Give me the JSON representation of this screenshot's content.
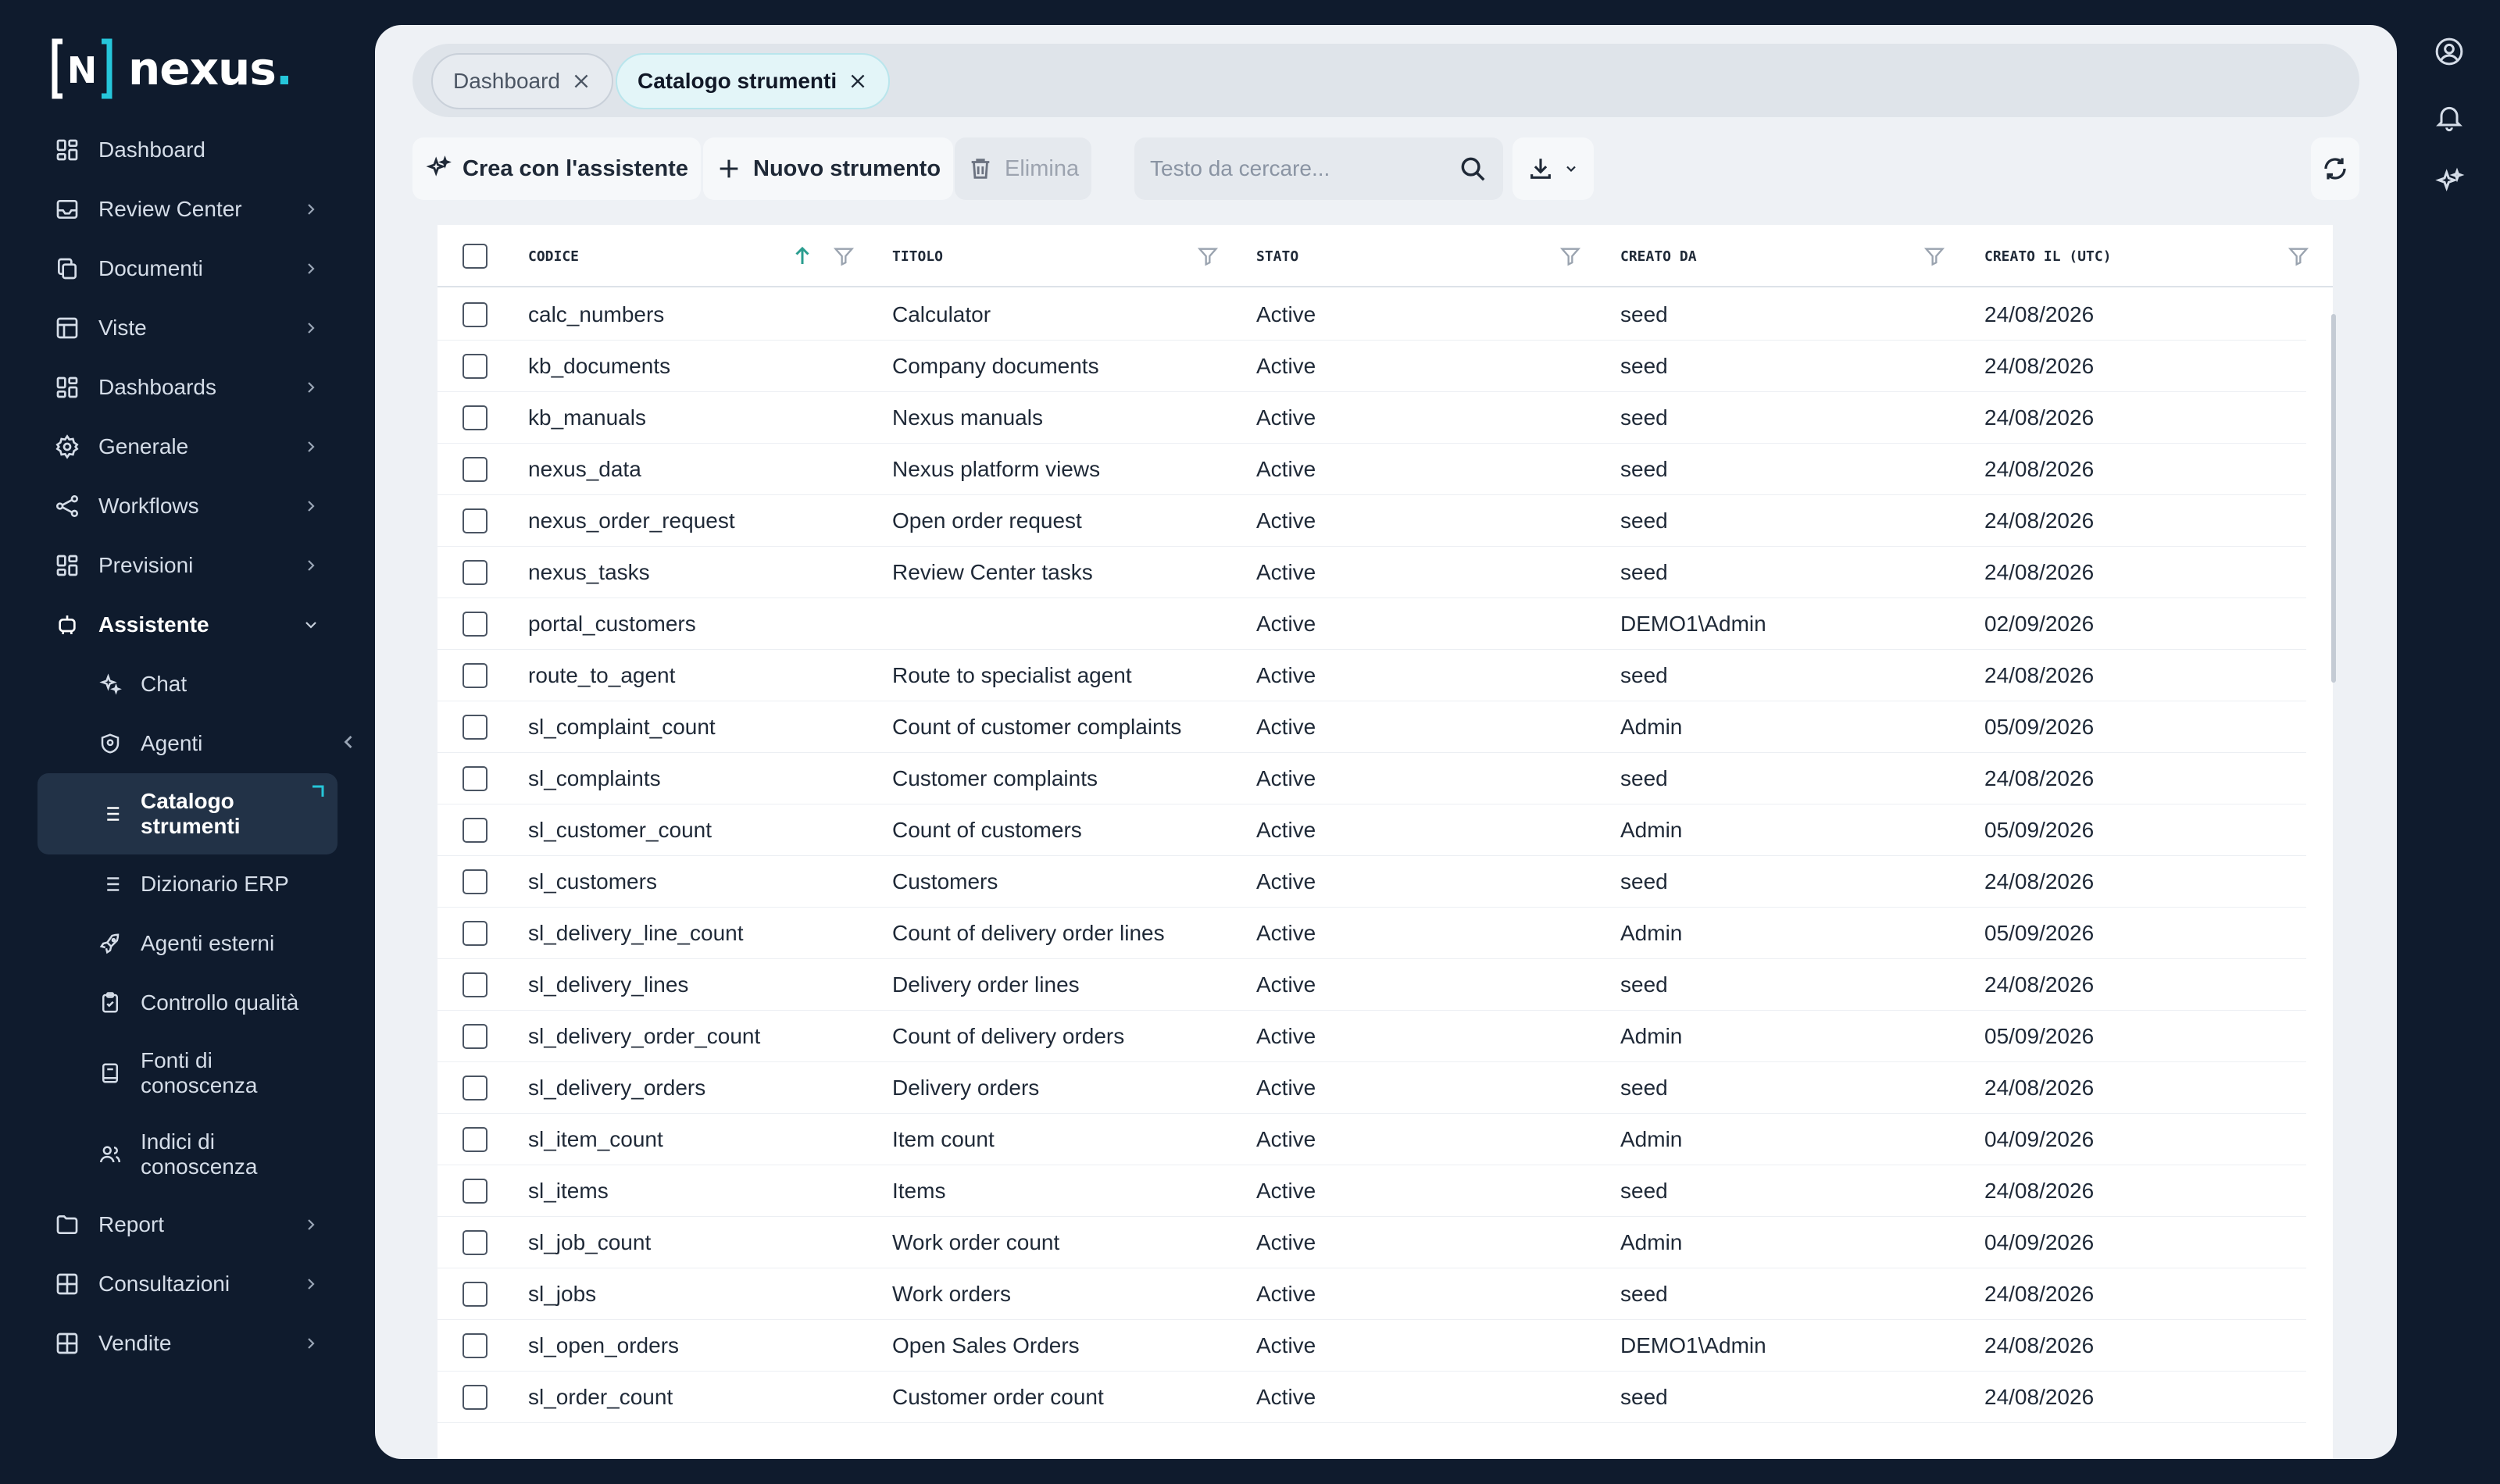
{
  "brand": {
    "name": "nexus",
    "dot": ".",
    "mark": "N"
  },
  "sidebar": {
    "items": [
      {
        "label": "Dashboard",
        "icon": "grid-icon",
        "chevron": false
      },
      {
        "label": "Review Center",
        "icon": "inbox-icon",
        "chevron": true
      },
      {
        "label": "Documenti",
        "icon": "copy-icon",
        "chevron": true
      },
      {
        "label": "Viste",
        "icon": "table-icon",
        "chevron": true
      },
      {
        "label": "Dashboards",
        "icon": "grid-icon",
        "chevron": true
      },
      {
        "label": "Generale",
        "icon": "gear-icon",
        "chevron": true
      },
      {
        "label": "Workflows",
        "icon": "share-icon",
        "chevron": true
      },
      {
        "label": "Previsioni",
        "icon": "grid-icon",
        "chevron": true
      },
      {
        "label": "Assistente",
        "icon": "robot-icon",
        "chevron": "down",
        "expanded": true
      }
    ],
    "assistant_children": [
      {
        "label": "Chat",
        "icon": "sparkle-icon"
      },
      {
        "label": "Agenti",
        "icon": "shield-icon"
      },
      {
        "label": "Catalogo strumenti",
        "icon": "list-icon",
        "active": true
      },
      {
        "label": "Dizionario ERP",
        "icon": "list-icon"
      },
      {
        "label": "Agenti esterni",
        "icon": "rocket-icon"
      },
      {
        "label": "Controllo qualità",
        "icon": "clipboard-icon"
      },
      {
        "label": "Fonti di conoscenza",
        "icon": "book-icon"
      },
      {
        "label": "Indici di conoscenza",
        "icon": "users-icon"
      }
    ],
    "bottom_items": [
      {
        "label": "Report",
        "icon": "folder-icon"
      },
      {
        "label": "Consultazioni",
        "icon": "table-icon"
      },
      {
        "label": "Vendite",
        "icon": "table-icon"
      }
    ]
  },
  "tabs": [
    {
      "label": "Dashboard",
      "active": false
    },
    {
      "label": "Catalogo strumenti",
      "active": true
    }
  ],
  "toolbar": {
    "assistant_label": "Crea con l'assistente",
    "new_label": "Nuovo strumento",
    "delete_label": "Elimina",
    "search_placeholder": "Testo da cercare..."
  },
  "table": {
    "columns": [
      "Codice",
      "Titolo",
      "Stato",
      "Creato da",
      "Creato il (UTC)"
    ],
    "sort": {
      "column": "Codice",
      "direction": "asc"
    },
    "rows": [
      [
        "calc_numbers",
        "Calculator",
        "Active",
        "seed",
        "24/08/2026"
      ],
      [
        "kb_documents",
        "Company documents",
        "Active",
        "seed",
        "24/08/2026"
      ],
      [
        "kb_manuals",
        "Nexus manuals",
        "Active",
        "seed",
        "24/08/2026"
      ],
      [
        "nexus_data",
        "Nexus platform views",
        "Active",
        "seed",
        "24/08/2026"
      ],
      [
        "nexus_order_request",
        "Open order request",
        "Active",
        "seed",
        "24/08/2026"
      ],
      [
        "nexus_tasks",
        "Review Center tasks",
        "Active",
        "seed",
        "24/08/2026"
      ],
      [
        "portal_customers",
        "",
        "Active",
        "DEMO1\\Admin",
        "02/09/2026"
      ],
      [
        "route_to_agent",
        "Route to specialist agent",
        "Active",
        "seed",
        "24/08/2026"
      ],
      [
        "sl_complaint_count",
        "Count of customer complaints",
        "Active",
        "Admin",
        "05/09/2026"
      ],
      [
        "sl_complaints",
        "Customer complaints",
        "Active",
        "seed",
        "24/08/2026"
      ],
      [
        "sl_customer_count",
        "Count of customers",
        "Active",
        "Admin",
        "05/09/2026"
      ],
      [
        "sl_customers",
        "Customers",
        "Active",
        "seed",
        "24/08/2026"
      ],
      [
        "sl_delivery_line_count",
        "Count of delivery order lines",
        "Active",
        "Admin",
        "05/09/2026"
      ],
      [
        "sl_delivery_lines",
        "Delivery order lines",
        "Active",
        "seed",
        "24/08/2026"
      ],
      [
        "sl_delivery_order_count",
        "Count of delivery orders",
        "Active",
        "Admin",
        "05/09/2026"
      ],
      [
        "sl_delivery_orders",
        "Delivery orders",
        "Active",
        "seed",
        "24/08/2026"
      ],
      [
        "sl_item_count",
        "Item count",
        "Active",
        "Admin",
        "04/09/2026"
      ],
      [
        "sl_items",
        "Items",
        "Active",
        "seed",
        "24/08/2026"
      ],
      [
        "sl_job_count",
        "Work order count",
        "Active",
        "Admin",
        "04/09/2026"
      ],
      [
        "sl_jobs",
        "Work orders",
        "Active",
        "seed",
        "24/08/2026"
      ],
      [
        "sl_open_orders",
        "Open Sales Orders",
        "Active",
        "DEMO1\\Admin",
        "24/08/2026"
      ],
      [
        "sl_order_count",
        "Customer order count",
        "Active",
        "seed",
        "24/08/2026"
      ]
    ]
  },
  "rail": [
    "user-circle-icon",
    "bell-icon",
    "sparkle-icon"
  ],
  "colors": {
    "background": "#0f1b2d",
    "panel": "#eef1f5",
    "accent": "#26c6da",
    "active_tab": "#e3f5f8"
  }
}
